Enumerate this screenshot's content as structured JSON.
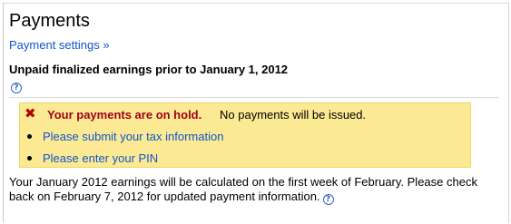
{
  "page": {
    "title": "Payments",
    "settings_link": "Payment settings »"
  },
  "earnings": {
    "heading": "Unpaid finalized earnings prior to January 1, 2012",
    "help_icon": "question-circle-icon"
  },
  "hold_notice": {
    "icon": "red-x-icon",
    "title": "Your payments are on hold.",
    "message": "No payments will be issued.",
    "background": "#fbea93",
    "title_color": "#a1001a",
    "links": [
      {
        "label": "Please submit your tax information"
      },
      {
        "label": "Please enter your PIN"
      }
    ]
  },
  "info": {
    "text": "Your January 2012 earnings will be calculated on the first week of February. Please check back on February 7, 2012 for updated payment information.",
    "help_icon": "question-circle-icon"
  },
  "colors": {
    "link": "#1155cc",
    "help": "#3366cc"
  }
}
